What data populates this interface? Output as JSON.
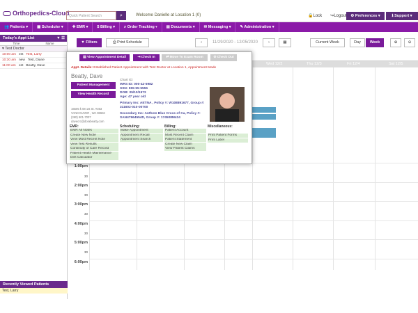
{
  "header": {
    "logo": "Orthopedics-Cloud",
    "search_placeholder": "Quick Patient Search",
    "welcome": "Welcome Danielle at Location 1 (0)",
    "lock": "Lock",
    "logout": "Logout",
    "preferences": "Preferences ▾",
    "support": "Support ▾"
  },
  "nav": [
    "Patients ▾",
    "Scheduler ▾",
    "EMR ▾",
    "Billing ▾",
    "Order Tracking ▾",
    "Documents ▾",
    "Messaging ▾",
    "Administration ▾"
  ],
  "left": {
    "title": "Today's Appt List",
    "col_time": "Time",
    "col_name": "Name",
    "doctor": "Test Doctor",
    "appts": [
      {
        "time": "10:00 am",
        "type": "est",
        "name": "Test, Larry"
      },
      {
        "time": "10:30 am",
        "type": "new",
        "name": "Test, Diane"
      },
      {
        "time": "11:00 am",
        "type": "est",
        "name": "Beatty, Dave"
      }
    ],
    "recent_title": "Recently Viewed Patients",
    "recent": "Test, Larry"
  },
  "toolbar": {
    "filters": "Filters",
    "print": "Print Schedule",
    "range": "11/29/2020 - 12/05/2020",
    "current_week": "Current Week",
    "day": "Day",
    "week": "Week"
  },
  "calendar": {
    "days": [
      "Thu 12/3",
      "Fri 12/4",
      "Sat 12/5"
    ],
    "wed": "Wed 12/2",
    "times": [
      "1:00pm",
      "2:00pm",
      "3:00pm",
      "4:00pm",
      "5:00pm",
      "6:00pm"
    ],
    "halfs": [
      "30",
      "30",
      "30",
      "30",
      "30"
    ]
  },
  "popup": {
    "buttons": {
      "view_appt": "View Appointment Detail",
      "check_in": "Check In",
      "move_exam": "Move To Exam Room",
      "check_out": "Check Out"
    },
    "appt_label": "Appt. Details:",
    "appt_text": "Established Patient Appointment with Test Doctor at Location 1, Appointment Made",
    "patient_name": "Beatty, Dave",
    "pm_button": "Patient Management",
    "hr_button": "View Health Record",
    "chart_id": "Chart ID:",
    "wrs": "WRS ID: 000-42-5982",
    "ssn": "SSN: 555-55-5555",
    "dob": "DOB: 05/10/1973",
    "age": "Age: 47 year old",
    "primary": "Primary Ins: AETNA , Policy #: W108891677, Group #: 311602-010-00700",
    "secondary": "Secondary Ins: Anthem Blue Cross of Ca, Policy #: SAN47964554D, Group #: 174508M424",
    "address": [
      "16505 k 08 1st St. #363",
      "VANCOUVER , WA 98684",
      "(360) 601-7007",
      "davecrc@dorabeatty.com"
    ],
    "emr_h": "EMR:",
    "sched_h": "Scheduling:",
    "billing_h": "Billing:",
    "misc_h": "Miscellaneous:",
    "emr": [
      "EMR All Notes",
      "Create New Note",
      "View Most Recent Note",
      "View Test Results",
      "Continuity of Care Record",
      "Patient Health Maintenance",
      "Diet Calculator"
    ],
    "sched": [
      "Make Appointment",
      "Appointment Recall",
      "Appointment Search"
    ],
    "billing": [
      "Patient Account",
      "Most Recent Claim",
      "Patient Statement",
      "Create New Claim",
      "View Patient Claims"
    ],
    "misc": [
      "Print Patient Forms",
      "Print Label"
    ]
  }
}
